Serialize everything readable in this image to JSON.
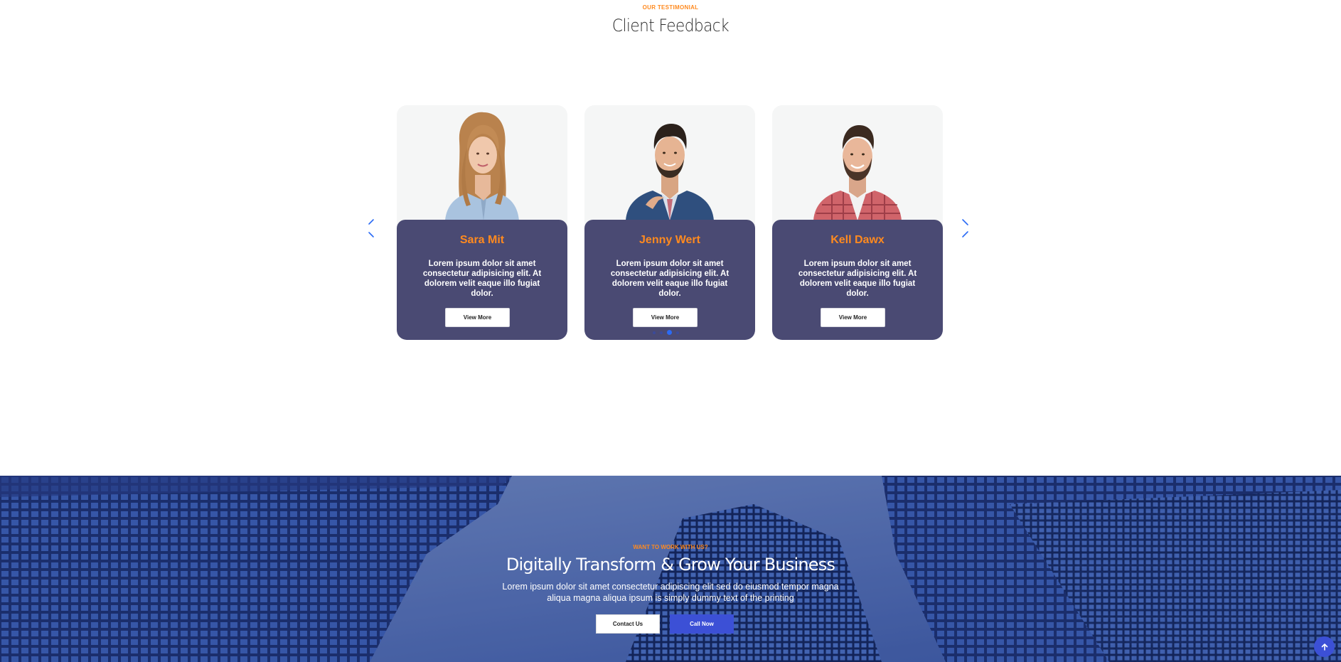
{
  "colors": {
    "accent": "#ff8a1f",
    "card_panel": "#4a4a73",
    "button_blue": "#3c50d6",
    "arrow_blue": "#2b6bf5",
    "to_top": "#3c50d6"
  },
  "testimonial": {
    "eyebrow": "OUR TESTIMONIAL",
    "title": "Client Feedback",
    "cards": [
      {
        "name": "Sara Mit",
        "text": "Lorem ipsum dolor sit amet consectetur adipisicing elit. At dolorem velit eaque illo fugiat dolor.",
        "button": "View More"
      },
      {
        "name": "Jenny Wert",
        "text": "Lorem ipsum dolor sit amet consectetur adipisicing elit. At dolorem velit eaque illo fugiat dolor.",
        "button": "View More"
      },
      {
        "name": "Kell Dawx",
        "text": "Lorem ipsum dolor sit amet consectetur adipisicing elit. At dolorem velit eaque illo fugiat dolor.",
        "button": "View More"
      }
    ],
    "pagination": {
      "count": 4,
      "active": 2
    },
    "icons": {
      "prev": "chevron-left-icon",
      "next": "chevron-right-icon"
    }
  },
  "cta": {
    "eyebrow": "WANT TO WORK WITH US?",
    "title": "Digitally Transform & Grow Your Business",
    "text": "Lorem ipsum dolor sit amet consectetur adipiscing elit sed do eiusmod tempor magna aliqua magna aliqua ipsum is simply dummy text of the printing",
    "contact_button": "Contact Us",
    "call_button": "Call Now"
  },
  "scroll_top_icon": "arrow-up-icon"
}
